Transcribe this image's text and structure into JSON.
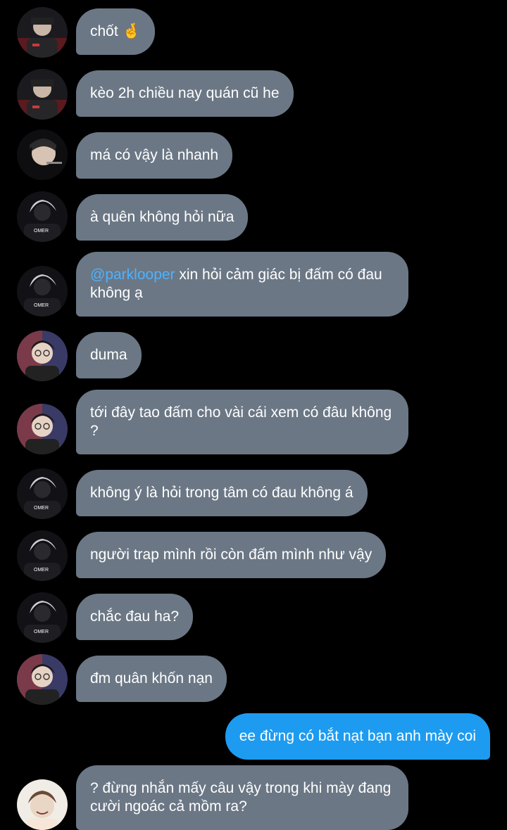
{
  "colors": {
    "background": "#000000",
    "incoming_bubble": "#6b7785",
    "outgoing_bubble": "#1d9bf0",
    "mention": "#4db2ff",
    "text": "#ffffff"
  },
  "messages": [
    {
      "avatar": "player-red-jersey-avatar",
      "text": "chốt",
      "emoji": "🤞"
    },
    {
      "avatar": "player-red-jersey-avatar",
      "text": "kèo 2h chiều nay quán cũ he"
    },
    {
      "avatar": "player-headset-avatar",
      "text": "má có vậy là nhanh"
    },
    {
      "avatar": "player-white-hair-avatar",
      "text": "à quên không hỏi nữa"
    },
    {
      "avatar": "player-white-hair-avatar",
      "mention": "@parklooper",
      "text": " xin hỏi cảm giác bị đấm có đau không ạ"
    },
    {
      "avatar": "player-glasses-avatar",
      "text": "duma"
    },
    {
      "avatar": "player-glasses-avatar",
      "text": "tới đây tao đấm cho vài cái xem có đâu không ?"
    },
    {
      "avatar": "player-white-hair-avatar",
      "text": "không ý là hỏi trong tâm có đau không á"
    },
    {
      "avatar": "player-white-hair-avatar",
      "text": "người trap mình rồi còn đấm mình như vậy"
    },
    {
      "avatar": "player-white-hair-avatar",
      "text": "chắc đau ha?"
    },
    {
      "avatar": "player-glasses-avatar",
      "text": "đm quân khốn nạn"
    },
    {
      "outgoing": true,
      "text": "ee đừng có bắt nạt bạn anh mày coi"
    },
    {
      "avatar": "player-smiling-avatar",
      "text": "? đừng nhắn mấy câu vậy trong khi mày đang cười ngoác cả mồm ra?"
    }
  ],
  "jersey_text": "OMER"
}
